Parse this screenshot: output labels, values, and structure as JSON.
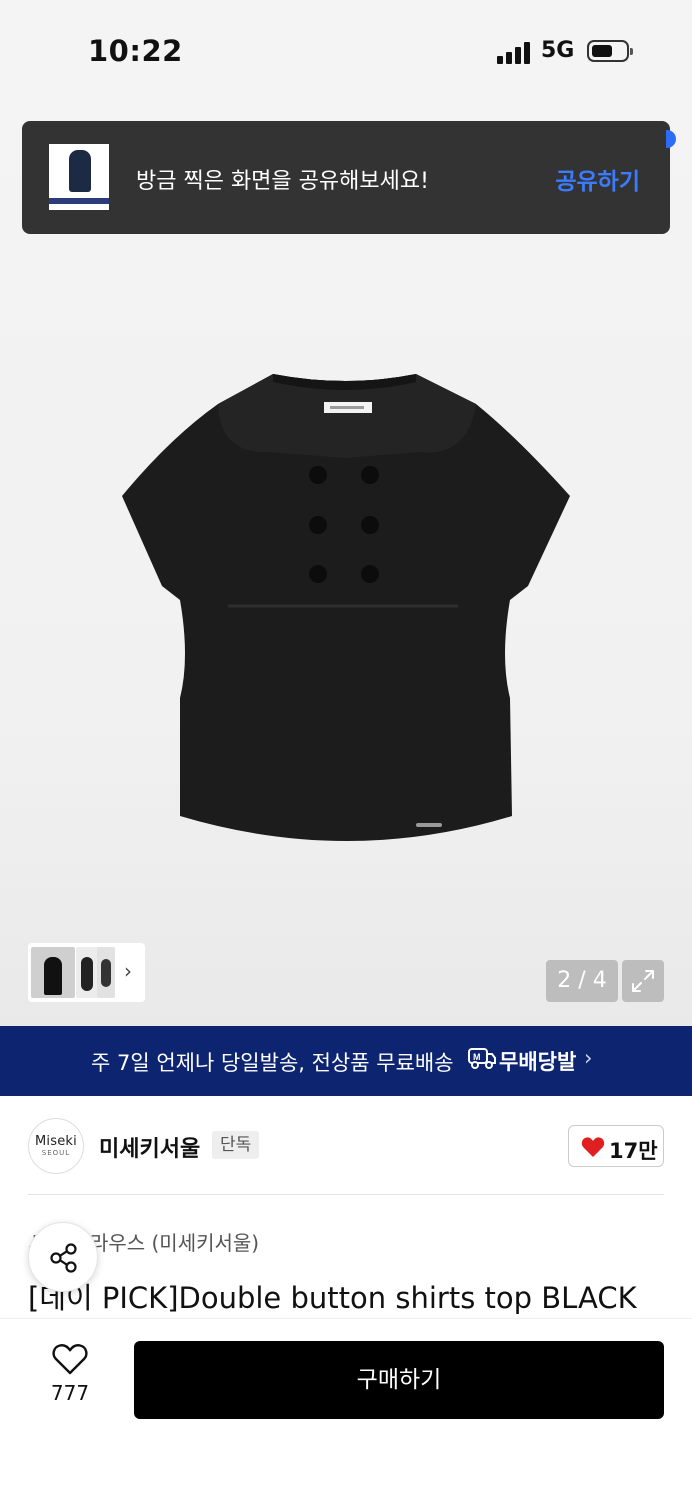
{
  "status_bar": {
    "time": "10:22",
    "network": "5G"
  },
  "toast": {
    "message": "방금 찍은 화면을 공유해보세요!",
    "action": "공유하기"
  },
  "gallery": {
    "counter": "2 / 4"
  },
  "shipping_banner": {
    "text": "주 7일 언제나 당일발송, 전상품 무료배송",
    "brand": "무배당발"
  },
  "brand": {
    "logo_text": "Miseki",
    "logo_sub": "SEOUL",
    "name": "미세키서울",
    "tag": "단독",
    "likes": "17만"
  },
  "product": {
    "category": "셔츠/블라우스 (미세키서울)",
    "title": "[데이 PICK]Double button shirts top BLACK"
  },
  "bottom_bar": {
    "wish_count": "777",
    "buy_label": "구매하기"
  },
  "colors": {
    "banner_bg": "#0d2470",
    "toast_action": "#3b7cff",
    "heart": "#e02020",
    "buy_bg": "#000000"
  }
}
